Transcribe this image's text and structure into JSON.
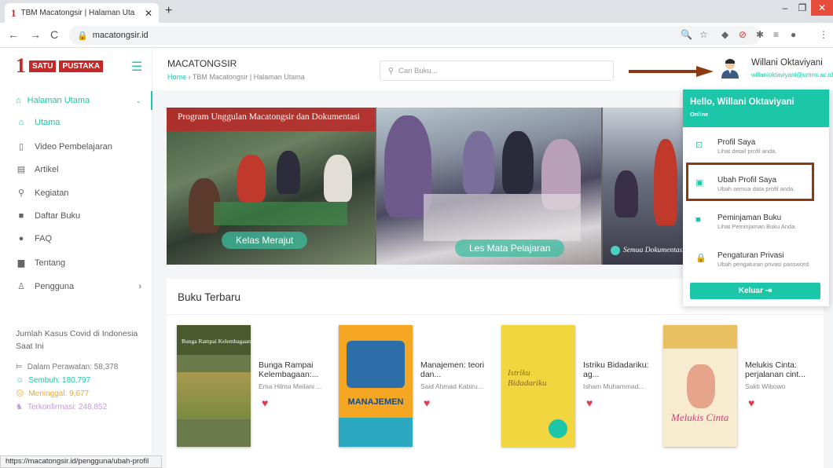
{
  "browser": {
    "tab_title": "TBM Macatongsir | Halaman Uta",
    "url": "macatongsir.id",
    "status_url": "https://macatongsir.id/pengguna/ubah-profil"
  },
  "logo": {
    "number": "1",
    "word1": "SATU",
    "word2": "PUSTAKA"
  },
  "sidebar": {
    "parent": "Halaman Utama",
    "items": [
      {
        "label": "Utama",
        "icon": "home-icon"
      },
      {
        "label": "Video Pembelajaran",
        "icon": "video-icon"
      },
      {
        "label": "Artikel",
        "icon": "article-icon"
      },
      {
        "label": "Kegiatan",
        "icon": "activity-icon"
      },
      {
        "label": "Daftar Buku",
        "icon": "book-icon"
      },
      {
        "label": "FAQ",
        "icon": "question-icon"
      },
      {
        "label": "Tentang",
        "icon": "info-icon"
      }
    ],
    "pengguna": "Pengguna"
  },
  "covid": {
    "title": "Jumlah Kasus Covid di Indonesia Saat Ini",
    "rawat": "Dalam Perawatan: 58,378",
    "sembuh": "Sembuh: 180,797",
    "meninggal": "Meninggal: 9,677",
    "terkonfirmasi": "Terkonfirmasi: 248,852",
    "colors": {
      "rawat": "#777777",
      "sembuh": "#1cc6a8",
      "meninggal": "#f5a623",
      "terkonfirmasi": "#c39bd3"
    }
  },
  "header": {
    "title": "MACATONGSIR",
    "crumb_home": "Home",
    "crumb_sep": "›",
    "crumb_page": "TBM Macatongsir | Halaman Utama",
    "search_placeholder": "Cari Buku..."
  },
  "user": {
    "name": "Willani Oktaviyani",
    "email": "willanioktaviyani@ummi.ac.id"
  },
  "slider": {
    "banner": "Program Unggulan Macatongsir dan Dokumentasi",
    "caption1": "Kelas Merajut",
    "caption2": "Les Mata Pelajaran",
    "caption3": "Semua Dokumentasi"
  },
  "books": {
    "heading": "Buku Terbaru",
    "items": [
      {
        "title": "Bunga Rampai Kelembagaan:...",
        "author": "Ema Hilma Meilani ...",
        "cover_title": "Bunga Rampai Kelembagaan"
      },
      {
        "title": "Manajemen: teori dan...",
        "author": "Said Ahmad Kabiru...",
        "cover_title": "MANAJEMEN"
      },
      {
        "title": "Istriku Bidadariku: ag...",
        "author": "Isham Muhammad...",
        "cover_title": "Istriku Bidadariku"
      },
      {
        "title": "Melukis Cinta: perjalanan cint...",
        "author": "Sakti Wibowo",
        "cover_title": "Melukis Cinta"
      }
    ]
  },
  "dropdown": {
    "hello": "Hello, Willani Oktaviyani",
    "status": "Online",
    "items": [
      {
        "title": "Profil Saya",
        "sub": "Lihat detail profil anda."
      },
      {
        "title": "Ubah Profil Saya",
        "sub": "Ubah semua data profil anda."
      },
      {
        "title": "Peminjaman Buku",
        "sub": "Lihat Peminjaman Buku Anda."
      },
      {
        "title": "Pengaturan Privasi",
        "sub": "Ubah pengaturan privasi password."
      }
    ],
    "logout": "Keluar"
  },
  "colors": {
    "accent": "#1cc6a8",
    "brand": "#c62828",
    "annotation": "#8b3a12"
  }
}
